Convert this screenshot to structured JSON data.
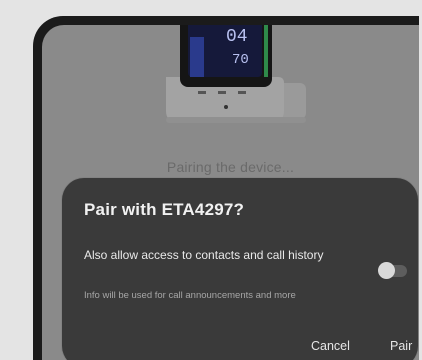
{
  "device_screen": {
    "reading_top": "04",
    "reading_bottom": "70"
  },
  "status_text": "Pairing the device...",
  "dialog": {
    "title": "Pair with ETA4297?",
    "option_label": "Also allow access to contacts and call history",
    "option_description": "Info will be used for call announcements and more",
    "option_toggle_on": false,
    "cancel_label": "Cancel",
    "pair_label": "Pair"
  },
  "colors": {
    "scrim": "#8a8a8a",
    "dialog_bg": "#3a3a3a",
    "device_screen_accent": "#3a4fa8",
    "device_indicator": "#2f8a4a"
  }
}
